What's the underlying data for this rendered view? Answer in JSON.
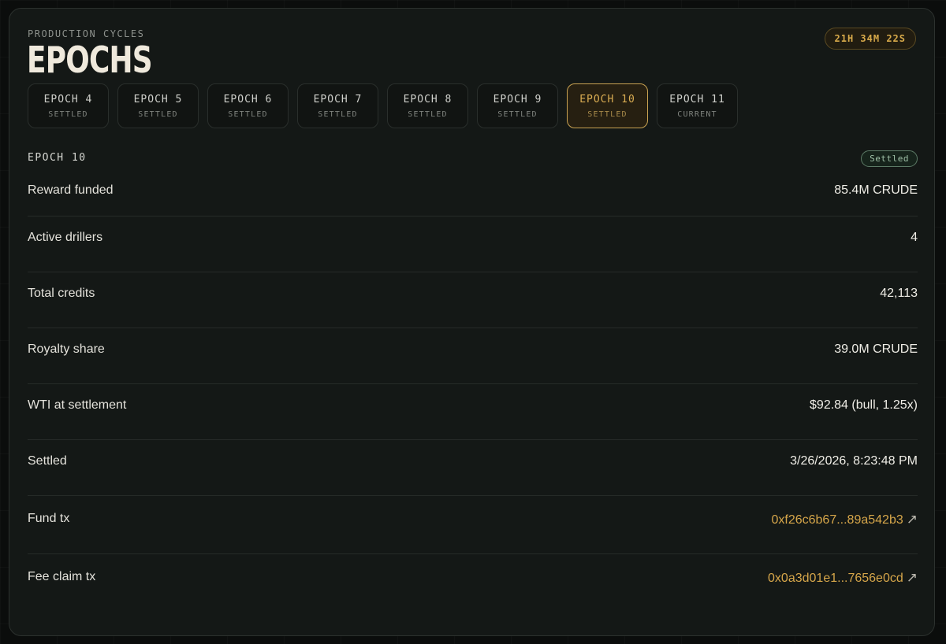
{
  "header": {
    "kicker": "PRODUCTION CYCLES",
    "title": "EPOCHS",
    "timer": "21H 34M 22S"
  },
  "tabs": [
    {
      "label": "EPOCH 4",
      "status": "SETTLED"
    },
    {
      "label": "EPOCH 5",
      "status": "SETTLED"
    },
    {
      "label": "EPOCH 6",
      "status": "SETTLED"
    },
    {
      "label": "EPOCH 7",
      "status": "SETTLED"
    },
    {
      "label": "EPOCH 8",
      "status": "SETTLED"
    },
    {
      "label": "EPOCH 9",
      "status": "SETTLED"
    },
    {
      "label": "EPOCH 10",
      "status": "SETTLED"
    },
    {
      "label": "EPOCH 11",
      "status": "CURRENT"
    }
  ],
  "selected_tab": "EPOCH 10",
  "detail": {
    "title": "EPOCH 10",
    "status": "Settled",
    "rows": [
      {
        "label": "Reward funded",
        "value": "85.4M CRUDE"
      },
      {
        "label": "Active drillers",
        "value": "4"
      },
      {
        "label": "Total credits",
        "value": "42,113"
      },
      {
        "label": "Royalty share",
        "value": "39.0M CRUDE"
      },
      {
        "label": "WTI at settlement",
        "value": "$92.84 (bull, 1.25x)"
      },
      {
        "label": "Settled",
        "value": "3/26/2026, 8:23:48 PM"
      },
      {
        "label": "Fund tx",
        "value": "0xf26c6b67...89a542b3",
        "icon": "external-link-arrow-icon"
      },
      {
        "label": "Fee claim tx",
        "value": "0x0a3d01e1...7656e0cd",
        "icon": "external-link-arrow-icon"
      }
    ]
  },
  "colors": {
    "accent": "#d6a64a",
    "panel": "#141816",
    "settled_badge": "#9fc0a7"
  }
}
